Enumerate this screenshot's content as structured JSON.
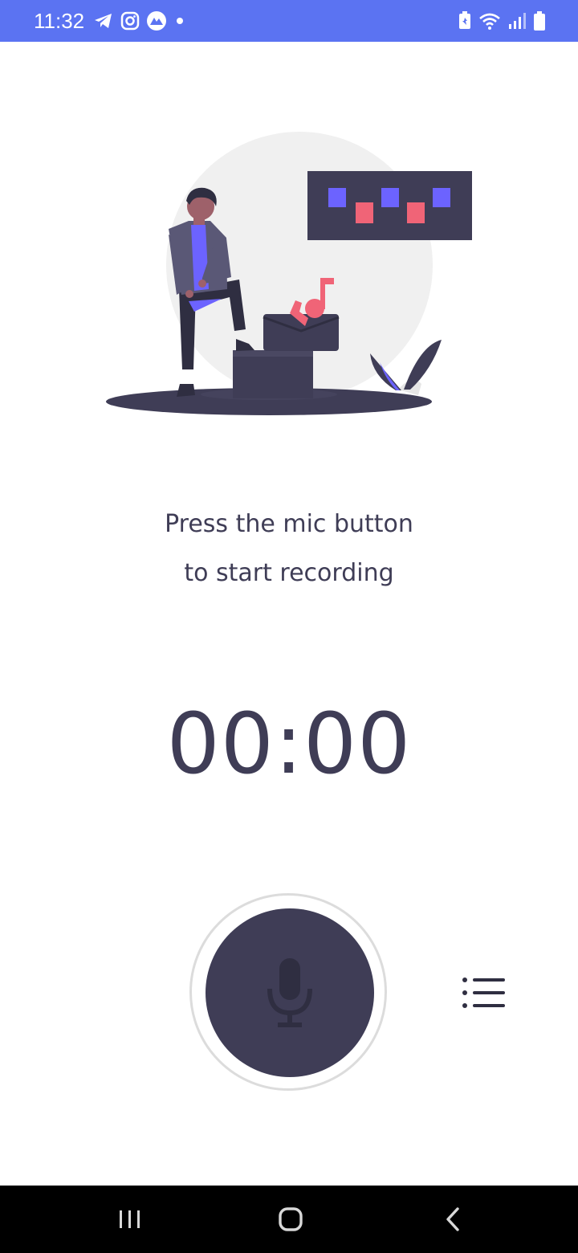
{
  "status_bar": {
    "time": "11:32",
    "left_icons": [
      "telegram-icon",
      "instagram-icon",
      "app-notification-icon",
      "more-notifications-dot"
    ],
    "right_icons": [
      "battery-saver-icon",
      "wifi-icon",
      "signal-icon",
      "battery-icon"
    ],
    "background_color": "#5b73f2"
  },
  "illustration": {
    "description_icon": "person-recording-music-illustration"
  },
  "prompt": {
    "line1": "Press the mic button",
    "line2": "to start recording"
  },
  "timer": {
    "value": "00:00"
  },
  "controls": {
    "mic_button_icon": "microphone-icon",
    "list_button_icon": "list-icon"
  },
  "nav_bar": {
    "buttons": [
      "recent-apps-icon",
      "home-icon",
      "back-icon"
    ]
  },
  "colors": {
    "primary_dark": "#3f3d56",
    "accent_purple": "#6c63ff",
    "accent_pink": "#f06477",
    "light_gray": "#f0f0f0"
  }
}
